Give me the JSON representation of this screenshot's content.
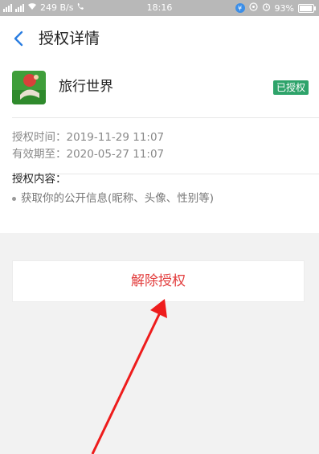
{
  "status_bar": {
    "network_speed": "249 B/s",
    "time": "18:16",
    "battery": "93%",
    "battery_level": 0.93
  },
  "header": {
    "title": "授权详情"
  },
  "app": {
    "name": "旅行世界",
    "status": "已授权",
    "status_color": "#2ea36a"
  },
  "auth_info": {
    "auth_time": "授权时间：2019-11-29 11:07",
    "expiry": "有效期至：2020-05-27 11:07"
  },
  "content": {
    "title": "授权内容：",
    "items": [
      "获取你的公开信息(昵称、头像、性别等)"
    ]
  },
  "actions": {
    "revoke_label": "解除授权",
    "revoke_color": "#e23c3c"
  },
  "annotation": {
    "arrow_color": "#ee1c1c"
  }
}
